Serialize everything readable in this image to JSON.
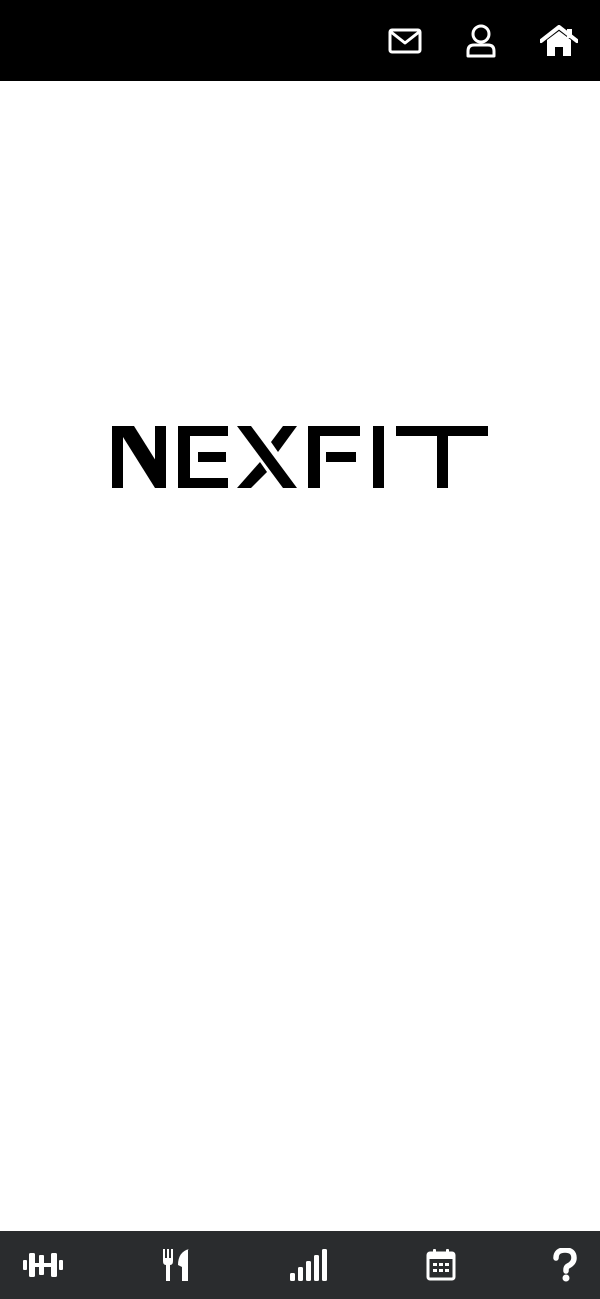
{
  "app": {
    "brand": "NEXFIT",
    "colors": {
      "topbar": "#000000",
      "bottombar": "#2a2c2e",
      "icon": "#ffffff",
      "logo": "#000000",
      "background": "#ffffff"
    }
  },
  "header": {
    "icons": [
      {
        "name": "mail-icon"
      },
      {
        "name": "user-icon"
      },
      {
        "name": "home-icon"
      }
    ]
  },
  "bottom_nav": {
    "items": [
      {
        "icon": "dumbbell-icon"
      },
      {
        "icon": "utensils-icon"
      },
      {
        "icon": "signal-bars-icon"
      },
      {
        "icon": "calendar-icon"
      },
      {
        "icon": "question-icon"
      }
    ]
  }
}
